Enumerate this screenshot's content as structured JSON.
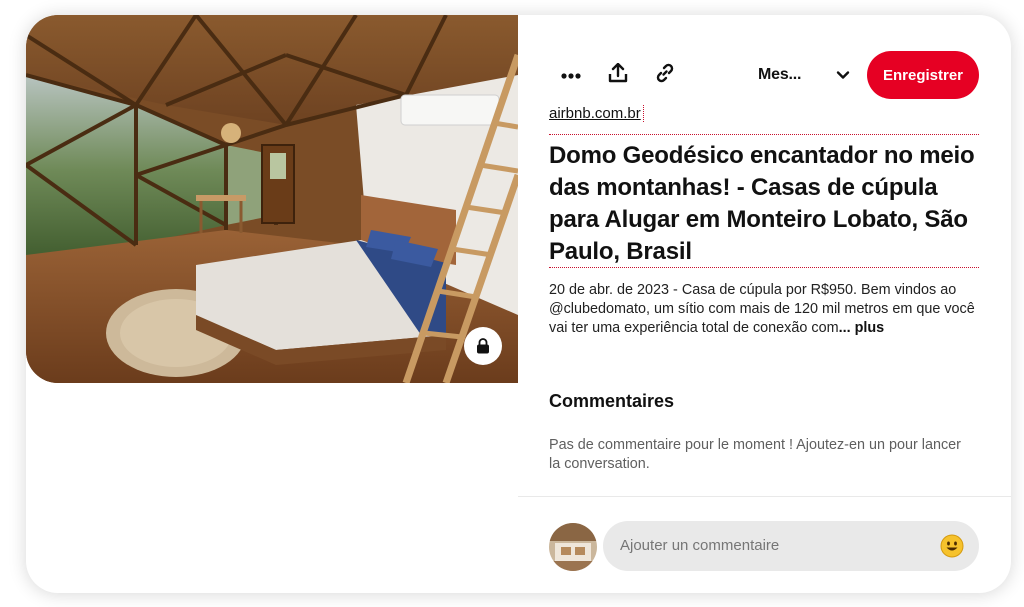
{
  "pin": {
    "image_alt": "Interior of geodesic dome with bed and wooden ladder",
    "toolbar": {
      "more_icon": "more-dots-icon",
      "share_icon": "share-upload-icon",
      "link_icon": "link-chain-icon",
      "board_label": "Mes...",
      "save_label": "Enregistrer"
    },
    "source": "airbnb.com.br",
    "title": "Domo Geodésico encantador no meio das montanhas! - Casas de cúpula para Alugar em Monteiro Lobato, São Paulo, Brasil",
    "description": "20 de abr. de 2023 - Casa de cúpula por R$950. Bem vindos ao @clubedomato, um sítio com mais de 120 mil metros em que você vai ter uma experiência total de conexão com",
    "more_label": "... plus",
    "comments": {
      "heading": "Commentaires",
      "empty_text": "Pas de commentaire pour le moment ! Ajoutez-en un pour lancer la conversation.",
      "input_placeholder": "Ajouter un commentaire"
    }
  },
  "colors": {
    "brand_red": "#e60023",
    "input_bg": "#e9e9e9"
  }
}
